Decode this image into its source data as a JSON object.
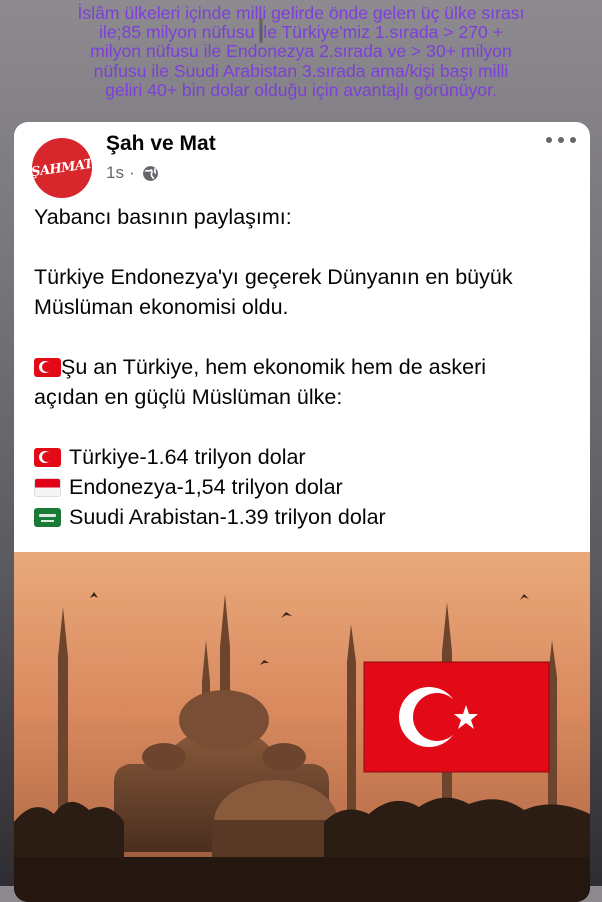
{
  "story_caption": {
    "lines": [
      "İslâm ülkeleri içinde milli gelirde önde gelen üç ülke sırası",
      "ile;85 milyon nüfusu ile Türkiye'miz 1.sırada > 270 +",
      "milyon nüfusu ile Endonezya 2.sırada ve > 30+ milyon",
      "nüfusu ile Suudi Arabistan 3.sırada ama/kişi başı milli",
      "geliri 40+ bin dolar olduğu için avantajlı görünüyor."
    ],
    "cursor_glyph": "I"
  },
  "post": {
    "page_name": "Şah ve Mat",
    "avatar_text": "ŞAHMAT",
    "time": "1s",
    "separator": "·",
    "body": {
      "intro": "Yabancı basının paylaşımı:",
      "headline_line1": "Türkiye Endonezya'yı geçerek Dünyanın en büyük",
      "headline_line2": "Müslüman ekonomisi oldu.",
      "statement_line1": "Şu an Türkiye, hem ekonomik hem de askeri",
      "statement_line2": "açıdan en güçlü Müslüman ülke:",
      "rankings": [
        {
          "flag": "turkey-flag-icon",
          "text": "Türkiye-1.64 trilyon dolar"
        },
        {
          "flag": "indonesia-flag-icon",
          "text": "Endonezya-1,54 trilyon dolar"
        },
        {
          "flag": "saudi-arabia-flag-icon",
          "text": "Suudi Arabistan-1.39 trilyon dolar"
        }
      ]
    },
    "image": {
      "description_icon": "mosque-with-turkish-flag-image",
      "flag_color": "#e30a17"
    }
  },
  "colors": {
    "caption": "#7d3fd9",
    "avatar_bg": "#d7262c",
    "text_primary": "#050505",
    "text_secondary": "#65676b"
  }
}
